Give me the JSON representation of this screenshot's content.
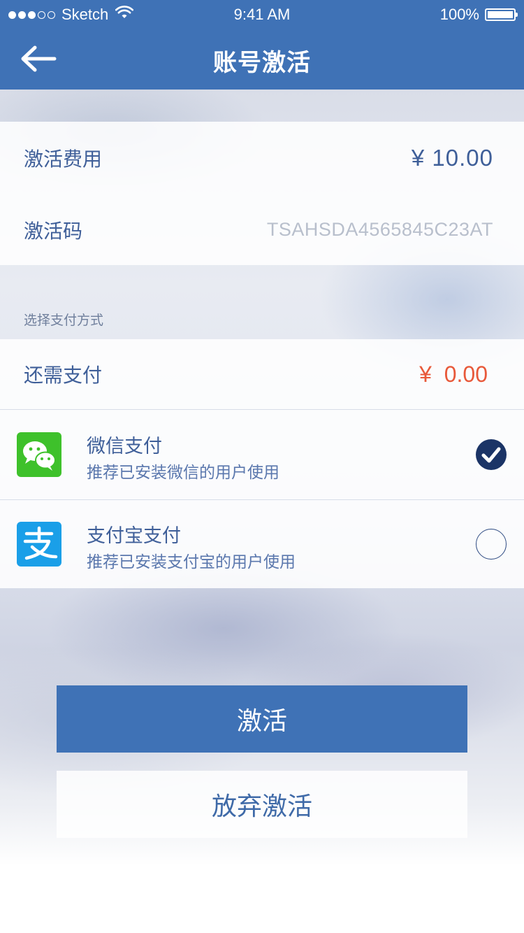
{
  "status_bar": {
    "carrier": "Sketch",
    "time": "9:41 AM",
    "battery": "100%",
    "battery_level": 1.0
  },
  "nav": {
    "title": "账号激活",
    "back_icon": "back-arrow-icon"
  },
  "activation": {
    "fee_label": "激活费用",
    "fee_value": "¥ 10.00",
    "code_label": "激活码",
    "code_value": "TSAHSDA4565845C23AT"
  },
  "payment": {
    "section_caption": "选择支付方式",
    "remaining_label": "还需支付",
    "remaining_value": "¥  0.00",
    "methods": [
      {
        "icon": "wechat-icon",
        "title": "微信支付",
        "subtitle": "推荐已安装微信的用户使用",
        "selected": true
      },
      {
        "icon": "alipay-icon",
        "title": "支付宝支付",
        "subtitle": "推荐已安装支付宝的用户使用",
        "selected": false
      }
    ]
  },
  "actions": {
    "activate_label": "激活",
    "abandon_label": "放弃激活"
  },
  "colors": {
    "brand_blue": "#3f72b6",
    "amount_red": "#e8593a",
    "wechat_green": "#3ec12b",
    "alipay_blue": "#1a9fe8",
    "check_navy": "#1b3466"
  }
}
